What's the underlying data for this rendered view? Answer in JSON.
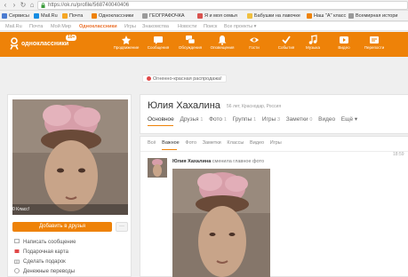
{
  "browser": {
    "url": "https://ok.ru/profile/568740040406",
    "bookmarks": [
      {
        "label": "Сервисы",
        "icon": "apps-icon",
        "color": "#4a7bd0"
      },
      {
        "label": "Mail.Ru",
        "icon": "mailru-icon",
        "color": "#168de2"
      },
      {
        "label": "Почта",
        "icon": "mail-icon",
        "color": "#f5a623"
      },
      {
        "label": "Одноклассники",
        "icon": "ok-icon",
        "color": "#ee8208"
      },
      {
        "label": "ГЕОГРАФОЧКА",
        "icon": "page-icon",
        "color": "#9a9a9a"
      },
      {
        "label": "Я и моя семья",
        "icon": "family-icon",
        "color": "#d9534f"
      },
      {
        "label": "Бабушки на лавочке",
        "icon": "folder-icon",
        "color": "#f0c040"
      },
      {
        "label": "Наш \"А\" класс",
        "icon": "ok-icon",
        "color": "#ee8208"
      },
      {
        "label": "Всемирная истори",
        "icon": "page-icon",
        "color": "#9a9a9a"
      }
    ]
  },
  "toplinks": [
    "Mail.Ru",
    "Почта",
    "Мой Мир",
    "Одноклассники",
    "Игры",
    "Знакомства",
    "Новости",
    "Поиск",
    "Все проекты ▾"
  ],
  "header": {
    "logo_text": "одноклассники",
    "badge": "10+",
    "nav": [
      {
        "label": "Продвижение",
        "icon": "promo-icon"
      },
      {
        "label": "Сообщения",
        "icon": "messages-icon"
      },
      {
        "label": "Обсуждения",
        "icon": "discussions-icon"
      },
      {
        "label": "Оповещения",
        "icon": "notifications-icon"
      },
      {
        "label": "Гости",
        "icon": "guests-icon"
      },
      {
        "label": "События",
        "icon": "events-icon"
      },
      {
        "label": "Музыка",
        "icon": "music-icon"
      },
      {
        "label": "Видео",
        "icon": "video-icon"
      },
      {
        "label": "Перепости",
        "icon": "reposts-icon"
      }
    ],
    "color": "#ee8208"
  },
  "notice": "Огненно-красная распродажа!",
  "left": {
    "photo_stats": "0  Класс!",
    "add_friend": "Добавить в друзья",
    "more": "···",
    "actions": [
      {
        "label": "Написать сообщение",
        "icon": "message-icon"
      },
      {
        "label": "Подарочная карта",
        "icon": "gift-card-icon"
      },
      {
        "label": "Сделать подарок",
        "icon": "gift-icon"
      },
      {
        "label": "Денежные переводы",
        "icon": "money-icon"
      }
    ]
  },
  "profile": {
    "name": "Юлия Хахалина",
    "info": "56 лет, Краснодар, Россия",
    "tabs": [
      {
        "label": "Основное",
        "count": ""
      },
      {
        "label": "Друзья",
        "count": "1"
      },
      {
        "label": "Фото",
        "count": "1"
      },
      {
        "label": "Группы",
        "count": "1"
      },
      {
        "label": "Игры",
        "count": "3"
      },
      {
        "label": "Заметки",
        "count": "0"
      },
      {
        "label": "Видео",
        "count": ""
      },
      {
        "label": "Ещё ▾",
        "count": ""
      }
    ]
  },
  "feed": {
    "tabs": [
      "Всё",
      "Важное",
      "Фото",
      "Заметки",
      "Классы",
      "Видео",
      "Игры"
    ],
    "post": {
      "author": "Юлия Хахалина",
      "action": "сменила главное фото",
      "time": "18:59"
    }
  }
}
